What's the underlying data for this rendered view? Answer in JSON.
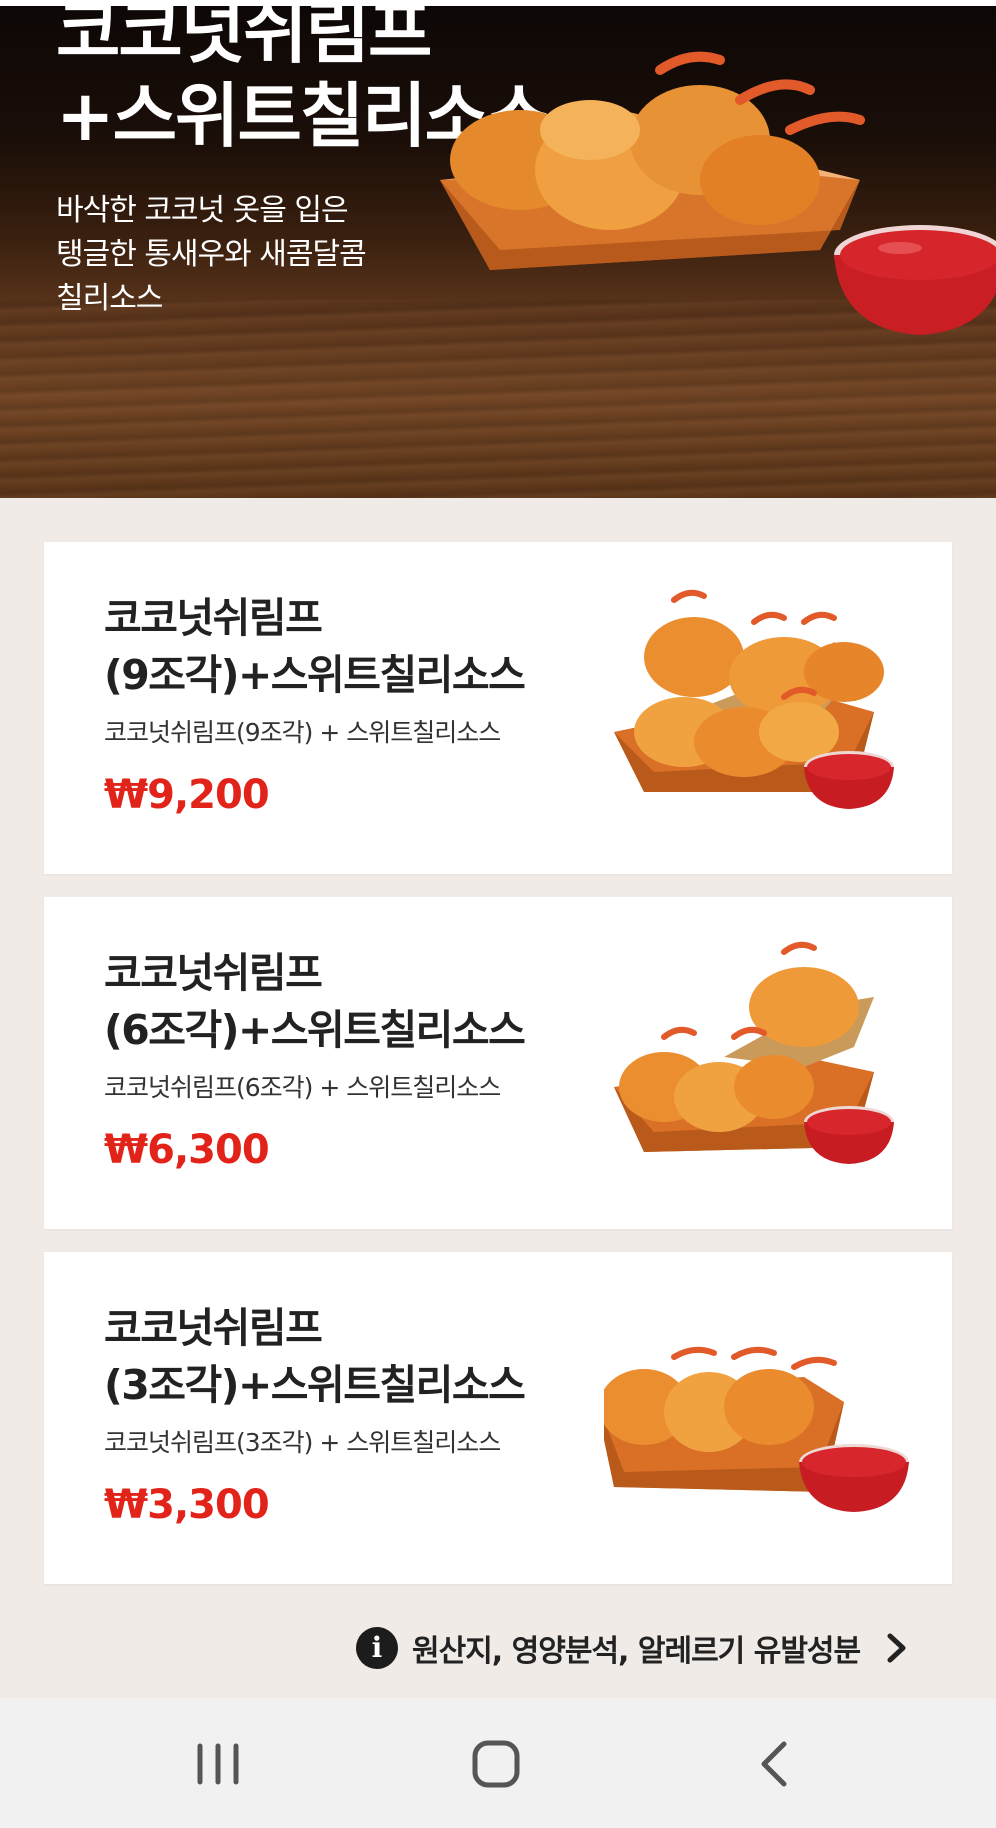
{
  "hero": {
    "title": "코코넛쉬림프\n+스위트칠리소스",
    "description": "바삭한 코코넛 옷을 입은\n탱글한 통새우와 새콤달콤\n칠리소스"
  },
  "products": [
    {
      "name_line1": "코코넛쉬림프",
      "name_line2": "(9조각)+스위트칠리소스",
      "components": "코코넛쉬림프(9조각) + 스위트칠리소스",
      "price": "₩9,200"
    },
    {
      "name_line1": "코코넛쉬림프",
      "name_line2": "(6조각)+스위트칠리소스",
      "components": "코코넛쉬림프(6조각) + 스위트칠리소스",
      "price": "₩6,300"
    },
    {
      "name_line1": "코코넛쉬림프",
      "name_line2": "(3조각)+스위트칠리소스",
      "components": "코코넛쉬림프(3조각) + 스위트칠리소스",
      "price": "₩3,300"
    }
  ],
  "info_link": {
    "icon": "info-icon",
    "label": "원산지, 영양분석, 알레르기 유발성분"
  },
  "navigation": {
    "recent_apps_icon": "recent-apps-icon",
    "home_icon": "home-icon",
    "back_icon": "back-icon"
  },
  "colors": {
    "price": "#e2231a",
    "page_background": "#f1ebe8",
    "nav_background": "#f1f1f1"
  }
}
